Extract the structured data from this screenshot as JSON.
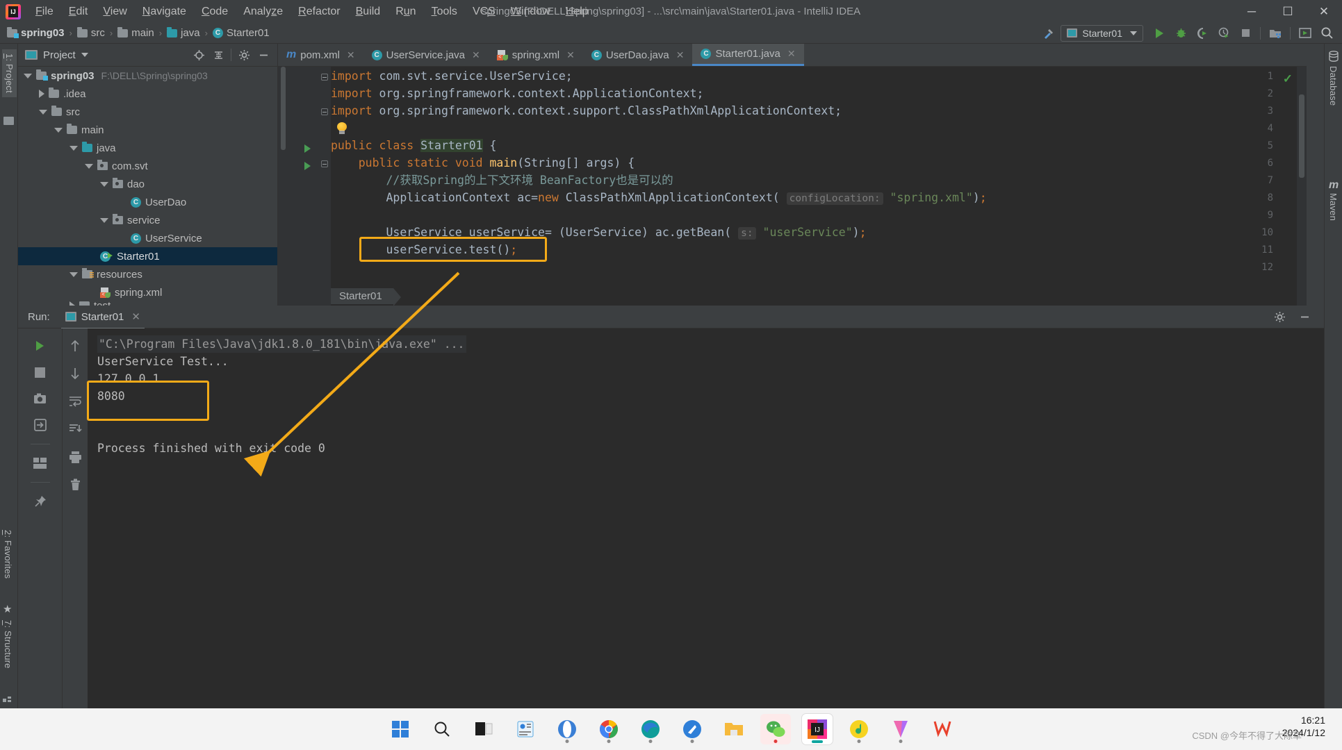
{
  "titlebar": {
    "app_icon": "intellij-logo",
    "title": "spring03 [F:\\DELL\\Spring\\spring03] - ...\\src\\main\\java\\Starter01.java - IntelliJ IDEA",
    "menu": [
      "File",
      "Edit",
      "View",
      "Navigate",
      "Code",
      "Analyze",
      "Refactor",
      "Build",
      "Run",
      "Tools",
      "VCS",
      "Window",
      "Help"
    ],
    "window_buttons": {
      "minimize": "─",
      "maximize": "☐",
      "close": "✕"
    }
  },
  "navbar": {
    "crumbs": [
      "spring03",
      "src",
      "main",
      "java",
      "Starter01"
    ],
    "separator": "›",
    "run_config": "Starter01",
    "icons": [
      "build-hammer-icon",
      "run-icon",
      "debug-icon",
      "run-coverage-icon",
      "profiler-icon",
      "stop-icon",
      "project-structure-icon",
      "update-app-icon",
      "search-everywhere-icon"
    ]
  },
  "left_strip": {
    "tabs": [
      "1: Project",
      "2: Favorites",
      "7: Structure"
    ]
  },
  "right_strip": {
    "tabs": [
      "Database",
      "Maven"
    ]
  },
  "project": {
    "header_title": "Project",
    "header_icons": [
      "locate-icon",
      "collapse-all-icon",
      "settings-gear-icon",
      "hide-icon"
    ],
    "tree": [
      {
        "indent": 0,
        "arrow": "down",
        "icon": "project-folder-icon",
        "label": "spring03",
        "bold": true,
        "path": "F:\\DELL\\Spring\\spring03",
        "selected": false
      },
      {
        "indent": 1,
        "arrow": "right",
        "icon": "folder-icon",
        "label": ".idea",
        "bold": false,
        "path": "",
        "selected": false
      },
      {
        "indent": 1,
        "arrow": "down",
        "icon": "folder-icon",
        "label": "src",
        "bold": false,
        "path": "",
        "selected": false
      },
      {
        "indent": 2,
        "arrow": "down",
        "icon": "folder-icon",
        "label": "main",
        "bold": false,
        "path": "",
        "selected": false
      },
      {
        "indent": 3,
        "arrow": "down",
        "icon": "source-folder-icon",
        "label": "java",
        "bold": false,
        "path": "",
        "selected": false
      },
      {
        "indent": 4,
        "arrow": "down",
        "icon": "package-icon",
        "label": "com.svt",
        "bold": false,
        "path": "",
        "selected": false
      },
      {
        "indent": 5,
        "arrow": "down",
        "icon": "package-icon",
        "label": "dao",
        "bold": false,
        "path": "",
        "selected": false
      },
      {
        "indent": 6,
        "arrow": "none",
        "icon": "java-class-icon",
        "label": "UserDao",
        "bold": false,
        "path": "",
        "selected": false
      },
      {
        "indent": 5,
        "arrow": "down",
        "icon": "package-icon",
        "label": "service",
        "bold": false,
        "path": "",
        "selected": false
      },
      {
        "indent": 6,
        "arrow": "none",
        "icon": "java-class-icon",
        "label": "UserService",
        "bold": false,
        "path": "",
        "selected": false
      },
      {
        "indent": 5,
        "arrow": "none",
        "icon": "runnable-class-icon",
        "label": "Starter01",
        "bold": false,
        "path": "",
        "selected": true
      },
      {
        "indent": 3,
        "arrow": "down",
        "icon": "resources-folder-icon",
        "label": "resources",
        "bold": false,
        "path": "",
        "selected": false
      },
      {
        "indent": 4,
        "arrow": "none",
        "icon": "spring-xml-icon",
        "label": "spring.xml",
        "bold": false,
        "path": "",
        "selected": false
      }
    ]
  },
  "editor": {
    "tabs": [
      {
        "label": "pom.xml",
        "icon": "maven-icon",
        "active": false
      },
      {
        "label": "UserService.java",
        "icon": "class-icon",
        "active": false
      },
      {
        "label": "spring.xml",
        "icon": "spring-icon",
        "active": false
      },
      {
        "label": "UserDao.java",
        "icon": "class-icon",
        "active": false
      },
      {
        "label": "Starter01.java",
        "icon": "class-icon",
        "active": true
      }
    ],
    "line_numbers": [
      "1",
      "2",
      "3",
      "4",
      "5",
      "6",
      "7",
      "8",
      "9",
      "10",
      "11",
      "12"
    ],
    "lines": [
      "import com.svt.service.UserService;",
      "import org.springframework.context.ApplicationContext;",
      "import org.springframework.context.support.ClassPathXmlApplicationContext;",
      "",
      "public class Starter01 {",
      "    public static void main(String[] args) {",
      "        //获取Spring的上下文环境 BeanFactory也是可以的",
      "        ApplicationContext ac=new ClassPathXmlApplicationContext( configLocation: \"spring.xml\");",
      "",
      "        UserService userService= (UserService) ac.getBean( s: \"userService\");",
      "        userService.test();",
      ""
    ],
    "param_hints": {
      "config_location": "configLocation:",
      "bean_name": "s:"
    },
    "string_literals": {
      "spring_xml": "\"spring.xml\"",
      "user_service": "\"userService\""
    },
    "breadcrumb_chip": "Starter01",
    "highlight_box_label": "userService.test();",
    "inspection_status": "✓"
  },
  "run_panel": {
    "label": "Run:",
    "tab": "Starter01",
    "close": "✕",
    "toolbar_left": [
      "rerun-icon",
      "stop-icon",
      "screenshot-icon",
      "export-icon",
      "layout-icon",
      "pin-icon"
    ],
    "toolbar_right": [
      "scroll-up-icon",
      "scroll-down-icon",
      "soft-wrap-icon",
      "scroll-to-end-icon",
      "print-icon",
      "trash-icon"
    ],
    "settings_icon": "gear-icon",
    "hide_icon": "minimize-icon",
    "output": [
      "\"C:\\Program Files\\Java\\jdk1.8.0_181\\bin\\java.exe\" ...",
      "UserService Test...",
      "127.0.0.1",
      "8080",
      "",
      "Process finished with exit code 0"
    ],
    "highlighted_output": [
      "127.0.0.1",
      "8080"
    ]
  },
  "annotations": {
    "box_color": "#f3aa18",
    "arrow": "arrow-from-code-to-console"
  },
  "taskbar": {
    "apps": [
      "windows-start-icon",
      "search-icon",
      "task-view-icon",
      "widgets-icon",
      "opera-icon",
      "chrome-icon",
      "edge-icon",
      "foxmail-icon",
      "explorer-icon",
      "wechat-icon",
      "intellij-icon",
      "qq-music-icon",
      "video-editor-icon",
      "wps-icon"
    ],
    "clock_time": "16:21",
    "clock_date": "2024/1/12",
    "watermark": "CSDN @今年不得了大除草"
  }
}
